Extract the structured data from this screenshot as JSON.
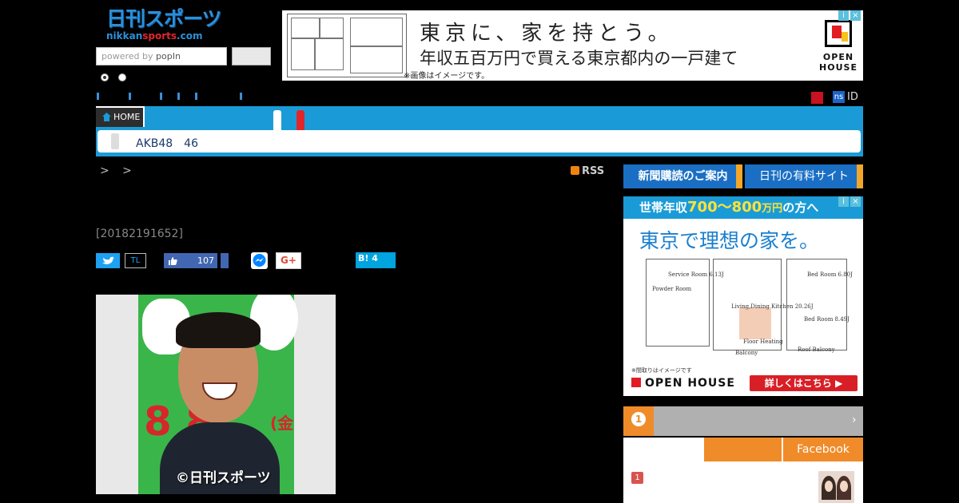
{
  "header": {
    "logo_main": "日刊スポーツ",
    "logo_sub_a": "nikkan",
    "logo_sub_b": "sports",
    "logo_sub_c": ".com",
    "search_placeholder_prefix": "powered by ",
    "search_placeholder_brand": "popIn"
  },
  "ad_top": {
    "headline": "東京に、家を持とう。",
    "subline": "年収五百万円で買える東京都内の一戸建て",
    "note": "※画像はイメージです。",
    "brand": "OPEN HOUSE",
    "ad_marks": [
      "i",
      "×"
    ]
  },
  "nav": {
    "home_label": "HOME",
    "ns_badge": "ns",
    "id_label": "ID",
    "subnav_text": "AKB48　46"
  },
  "article": {
    "breadcrumb": "> >",
    "rss_label": "RSS",
    "date": "[20182191652]",
    "tl_label": "TL",
    "like_count": "107",
    "gplus_label": "G+",
    "hatena_label": "B! 4",
    "photo_num": "8 8",
    "photo_kin": "(金",
    "photo_credit": "©日刊スポーツ"
  },
  "sidebar": {
    "subscribe_label": "新聞購読のご案内",
    "paid_site_label": "日刊の有料サイト",
    "ad": {
      "top_prefix": "世帯年収",
      "top_range": "700〜800",
      "top_unit": "万円",
      "top_suffix": "の方へ",
      "headline": "東京で理想の家を。",
      "note": "※間取りはイメージです",
      "brand": "OPEN HOUSE",
      "cta": "詳しくはこちら ▶",
      "rooms": [
        "Service Room 6.13J",
        "Powder Room",
        "Living,Dining Kitchen 20.26J",
        "Floor Heating",
        "Bed Room 6.80J",
        "Bed Room 8.49J",
        "Roof Balcony",
        "Balcony"
      ],
      "ad_marks": [
        "i",
        "×"
      ]
    },
    "ranking_arrow": "›",
    "facebook_tab": "Facebook",
    "rank_number": "1"
  },
  "colors": {
    "nav_blue": "#1a9bd7",
    "accent_orange": "#f08b29",
    "brand_red": "#e0262b"
  }
}
